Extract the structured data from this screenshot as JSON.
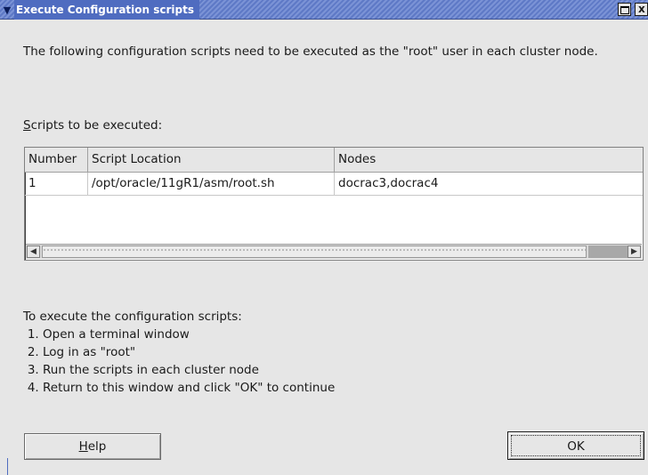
{
  "window": {
    "title": "Execute Configuration scripts",
    "menu_glyph": "▼",
    "close_glyph": "x"
  },
  "description": "The following configuration scripts need to be executed as the \"root\" user in each cluster node.",
  "scripts_label": {
    "mnemonic": "S",
    "rest": "cripts to be executed:"
  },
  "table": {
    "columns": [
      "Number",
      "Script Location",
      "Nodes"
    ],
    "rows": [
      {
        "number": "1",
        "location": "/opt/oracle/11gR1/asm/root.sh",
        "nodes": "docrac3,docrac4"
      }
    ]
  },
  "instructions": {
    "heading": "To execute the configuration scripts:",
    "steps": [
      "Open a terminal window",
      "Log in as \"root\"",
      "Run the scripts in each cluster node",
      "Return to this window and click \"OK\" to continue"
    ]
  },
  "buttons": {
    "help_mnemonic": "H",
    "help_rest": "elp",
    "ok": "OK"
  },
  "icons": {
    "scroll_left": "◀",
    "scroll_right": "▶"
  }
}
